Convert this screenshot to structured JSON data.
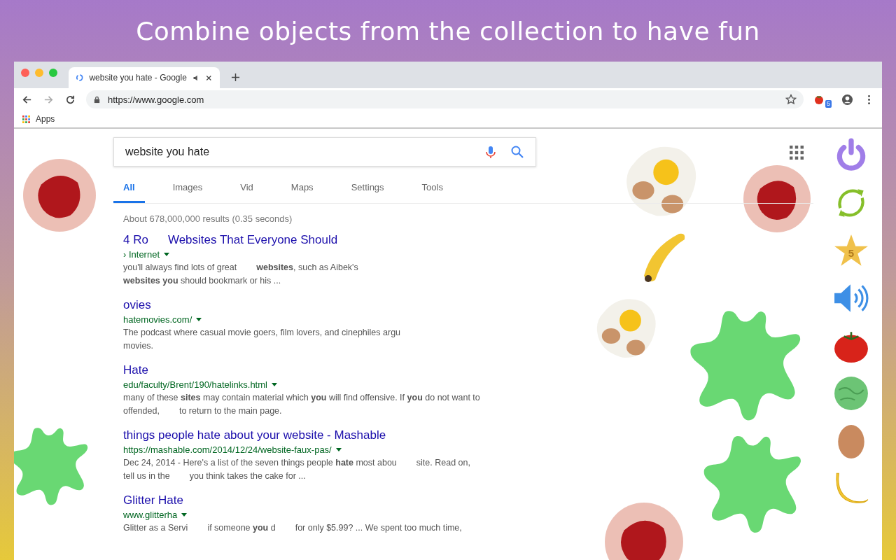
{
  "headline": "Combine objects from the collection to have fun",
  "browser": {
    "tab_title": "website you hate - Google",
    "url": "https://www.google.com",
    "bookmark": "Apps",
    "extension_badge": "5"
  },
  "search": {
    "value": "website you hate"
  },
  "tabs": [
    {
      "label": "All",
      "selected": true
    },
    {
      "label": "Images",
      "selected": false
    },
    {
      "label": "Vid",
      "selected": false
    },
    {
      "label": "Maps",
      "selected": false
    },
    {
      "label": "Settings",
      "selected": false
    },
    {
      "label": "Tools",
      "selected": false
    }
  ],
  "stats": "About 678,000,000 results (0.35 seconds)",
  "results": [
    {
      "title": [
        "4 Ro",
        "Websites That Everyone Should"
      ],
      "url": [
        "› Internet"
      ],
      "lines": [
        [
          "you'll always find lots of great",
          "**websites**, such as Aibek's"
        ],
        [
          "**websites** **you** should bookmark or his ..."
        ]
      ]
    },
    {
      "title": [
        "ovies"
      ],
      "url": [
        "hatemovies.com/"
      ],
      "lines": [
        [
          "The podcast where casual movie goers, film lovers, and cinephiles argu"
        ],
        [
          "movies."
        ]
      ]
    },
    {
      "title": [
        "Hate"
      ],
      "url": [
        "edu/faculty/Brent/190/hatelinks.html"
      ],
      "lines": [
        [
          "many of these **sites** may contain material which **you** will find offensive. If **you** do not want to"
        ],
        [
          "offended,",
          "to return to the main page."
        ]
      ]
    },
    {
      "title": [
        "things people hate about your website - Mashable"
      ],
      "url": [
        "https://mashable.com/2014/12/24/website-faux-pas/"
      ],
      "lines": [
        [
          "Dec 24, 2014 - Here's a list of the seven things people **hate** most abou",
          "site. Read on,"
        ],
        [
          "tell us in the",
          "you think takes the cake for ..."
        ]
      ]
    },
    {
      "title": [
        "Glitter Hate"
      ],
      "url": [
        "www.glitterha"
      ],
      "lines": [
        [
          "Glitter as a Servi",
          "if someone **you** d",
          "for only $5.99? ... We spent too much time,"
        ]
      ]
    }
  ],
  "sidebar": [
    {
      "kind": "power"
    },
    {
      "kind": "refresh"
    },
    {
      "kind": "star",
      "label": "5"
    },
    {
      "kind": "sound"
    },
    {
      "kind": "tomato"
    },
    {
      "kind": "ball"
    },
    {
      "kind": "egg"
    },
    {
      "kind": "banana"
    }
  ]
}
